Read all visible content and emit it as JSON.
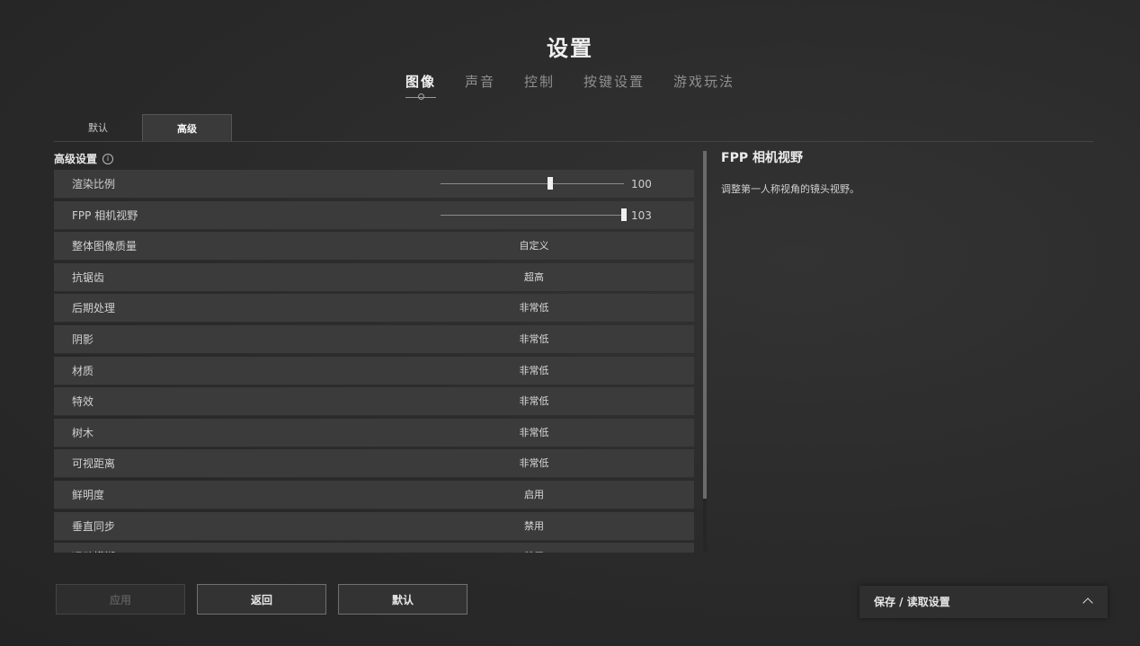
{
  "title": "设置",
  "main_tabs": [
    {
      "label": "图像",
      "active": true
    },
    {
      "label": "声音",
      "active": false
    },
    {
      "label": "控制",
      "active": false
    },
    {
      "label": "按键设置",
      "active": false
    },
    {
      "label": "游戏玩法",
      "active": false
    }
  ],
  "sub_tabs": [
    {
      "label": "默认",
      "active": false
    },
    {
      "label": "高级",
      "active": true
    }
  ],
  "section_title": "高级设置",
  "info_icon": "i",
  "settings": [
    {
      "label": "渲染比例",
      "type": "slider",
      "value": "100",
      "fraction": 0.6
    },
    {
      "label": "FPP 相机视野",
      "type": "slider",
      "value": "103",
      "fraction": 1.0
    },
    {
      "label": "整体图像质量",
      "type": "option",
      "value": "自定义"
    },
    {
      "label": "抗锯齿",
      "type": "option",
      "value": "超高"
    },
    {
      "label": "后期处理",
      "type": "option",
      "value": "非常低"
    },
    {
      "label": "阴影",
      "type": "option",
      "value": "非常低"
    },
    {
      "label": "材质",
      "type": "option",
      "value": "非常低"
    },
    {
      "label": "特效",
      "type": "option",
      "value": "非常低"
    },
    {
      "label": "树木",
      "type": "option",
      "value": "非常低"
    },
    {
      "label": "可视距离",
      "type": "option",
      "value": "非常低"
    },
    {
      "label": "鲜明度",
      "type": "option",
      "value": "启用"
    },
    {
      "label": "垂直同步",
      "type": "option",
      "value": "禁用"
    },
    {
      "label": "运动模糊",
      "type": "option",
      "value": "禁用"
    }
  ],
  "info_panel": {
    "title": "FPP 相机视野",
    "description": "调整第一人称视角的镜头视野。"
  },
  "buttons": {
    "apply": "应用",
    "back": "返回",
    "default": "默认"
  },
  "save_panel_label": "保存 / 读取设置"
}
